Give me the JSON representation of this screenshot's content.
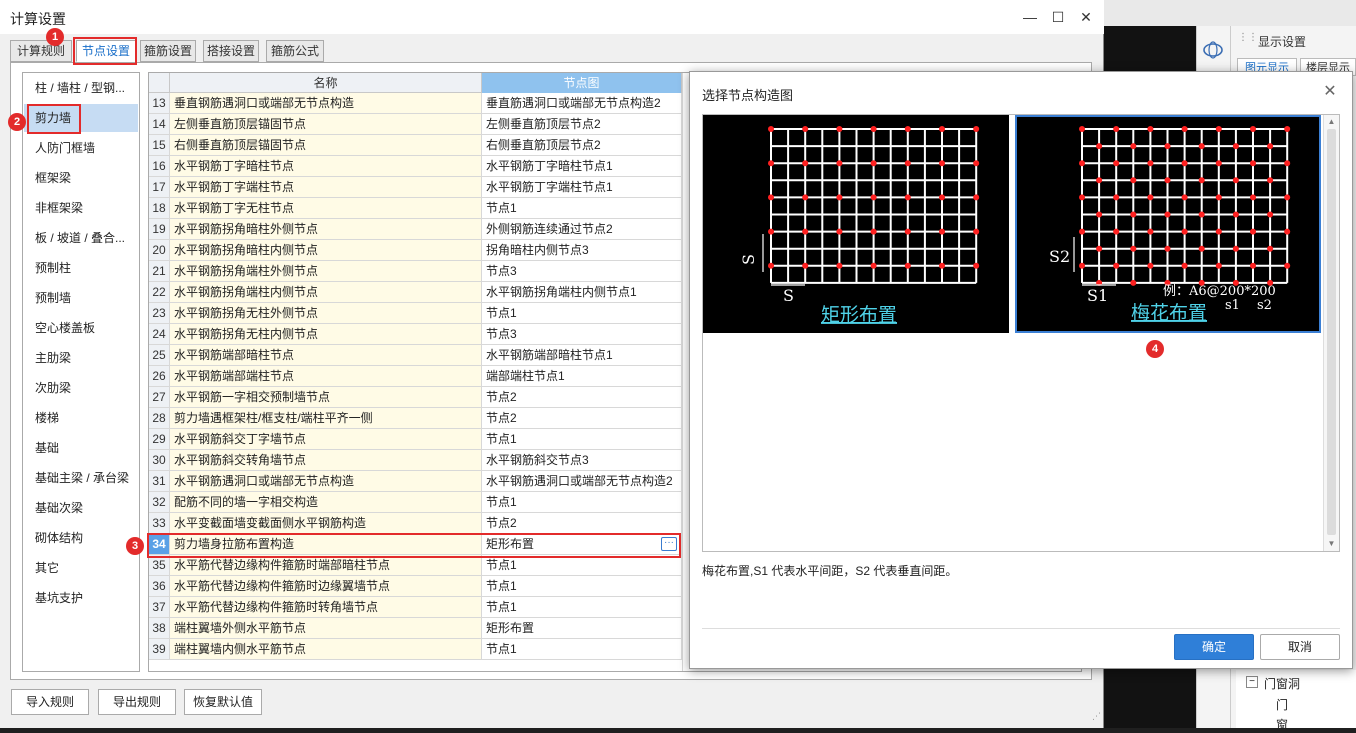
{
  "window": {
    "title": "计算设置",
    "minimize": "—",
    "maximize": "☐",
    "close": "✕"
  },
  "tabs": [
    "计算规则",
    "节点设置",
    "箍筋设置",
    "搭接设置",
    "箍筋公式"
  ],
  "categories": [
    "柱 / 墙柱 / 型钢...",
    "剪力墙",
    "人防门框墙",
    "框架梁",
    "非框架梁",
    "板 / 坡道 / 叠合...",
    "预制柱",
    "预制墙",
    "空心楼盖板",
    "主肋梁",
    "次肋梁",
    "楼梯",
    "基础",
    "基础主梁 / 承台梁",
    "基础次梁",
    "砌体结构",
    "其它",
    "基坑支护"
  ],
  "grid": {
    "headers": {
      "name": "名称",
      "node": "节点图"
    },
    "rows": [
      {
        "num": "13",
        "name": "垂直钢筋遇洞口或端部无节点构造",
        "node": "垂直筋遇洞口或端部无节点构造2"
      },
      {
        "num": "14",
        "name": "左侧垂直筋顶层锚固节点",
        "node": "左侧垂直筋顶层节点2"
      },
      {
        "num": "15",
        "name": "右侧垂直筋顶层锚固节点",
        "node": "右侧垂直筋顶层节点2"
      },
      {
        "num": "16",
        "name": "水平钢筋丁字暗柱节点",
        "node": "水平钢筋丁字暗柱节点1"
      },
      {
        "num": "17",
        "name": "水平钢筋丁字端柱节点",
        "node": "水平钢筋丁字端柱节点1"
      },
      {
        "num": "18",
        "name": "水平钢筋丁字无柱节点",
        "node": "节点1"
      },
      {
        "num": "19",
        "name": "水平钢筋拐角暗柱外侧节点",
        "node": "外侧钢筋连续通过节点2"
      },
      {
        "num": "20",
        "name": "水平钢筋拐角暗柱内侧节点",
        "node": "拐角暗柱内侧节点3"
      },
      {
        "num": "21",
        "name": "水平钢筋拐角端柱外侧节点",
        "node": "节点3"
      },
      {
        "num": "22",
        "name": "水平钢筋拐角端柱内侧节点",
        "node": "水平钢筋拐角端柱内侧节点1"
      },
      {
        "num": "23",
        "name": "水平钢筋拐角无柱外侧节点",
        "node": "节点1"
      },
      {
        "num": "24",
        "name": "水平钢筋拐角无柱内侧节点",
        "node": "节点3"
      },
      {
        "num": "25",
        "name": "水平钢筋端部暗柱节点",
        "node": "水平钢筋端部暗柱节点1"
      },
      {
        "num": "26",
        "name": "水平钢筋端部端柱节点",
        "node": "端部端柱节点1"
      },
      {
        "num": "27",
        "name": "水平钢筋一字相交预制墙节点",
        "node": "节点2"
      },
      {
        "num": "28",
        "name": "剪力墙遇框架柱/框支柱/端柱平齐一侧",
        "node": "节点2"
      },
      {
        "num": "29",
        "name": "水平钢筋斜交丁字墙节点",
        "node": "节点1"
      },
      {
        "num": "30",
        "name": "水平钢筋斜交转角墙节点",
        "node": "水平钢筋斜交节点3"
      },
      {
        "num": "31",
        "name": "水平钢筋遇洞口或端部无节点构造",
        "node": "水平钢筋遇洞口或端部无节点构造2"
      },
      {
        "num": "32",
        "name": "配筋不同的墙一字相交构造",
        "node": "节点1"
      },
      {
        "num": "33",
        "name": "水平变截面墙变截面侧水平钢筋构造",
        "node": "节点2"
      },
      {
        "num": "34",
        "name": "剪力墙身拉筋布置构造",
        "node": "矩形布置"
      },
      {
        "num": "35",
        "name": "水平筋代替边缘构件箍筋时端部暗柱节点",
        "node": "节点1"
      },
      {
        "num": "36",
        "name": "水平筋代替边缘构件箍筋时边缘翼墙节点",
        "node": "节点1"
      },
      {
        "num": "37",
        "name": "水平筋代替边缘构件箍筋时转角墙节点",
        "node": "节点1"
      },
      {
        "num": "38",
        "name": "端柱翼墙外侧水平筋节点",
        "node": "矩形布置"
      },
      {
        "num": "39",
        "name": "端柱翼墙内侧水平筋节点",
        "node": "节点1"
      }
    ],
    "ellipsis": "···"
  },
  "badges": [
    "1",
    "2",
    "3",
    "4"
  ],
  "bottom_buttons": {
    "import": "导入规则",
    "export": "导出规则",
    "restore": "恢复默认值"
  },
  "right_panel": {
    "title": "显示设置",
    "tabs": [
      "图元显示",
      "楼层显示"
    ],
    "tree": {
      "group": "门窗洞",
      "items": [
        "门",
        "窗"
      ],
      "collapse": "−"
    }
  },
  "dialog": {
    "title": "选择节点构造图",
    "close": "✕",
    "thumbs": [
      {
        "caption": "矩形布置",
        "dim_v": "S",
        "dim_h": "S"
      },
      {
        "caption": "梅花布置",
        "dim_v": "S2",
        "dim_h": "S1",
        "example": "例：A6@200*200",
        "s1": "s1",
        "s2": "s2"
      }
    ],
    "description": "梅花布置,S1 代表水平间距，S2 代表垂直间距。",
    "ok": "确定",
    "cancel": "取消",
    "scroll_up": "▲",
    "scroll_down": "▼"
  },
  "colors": {
    "accent": "#2f7fd8",
    "highlight_red": "#e32b2b",
    "cad_cyan": "#4fd2e8",
    "cad_dot": "#ff2020"
  }
}
